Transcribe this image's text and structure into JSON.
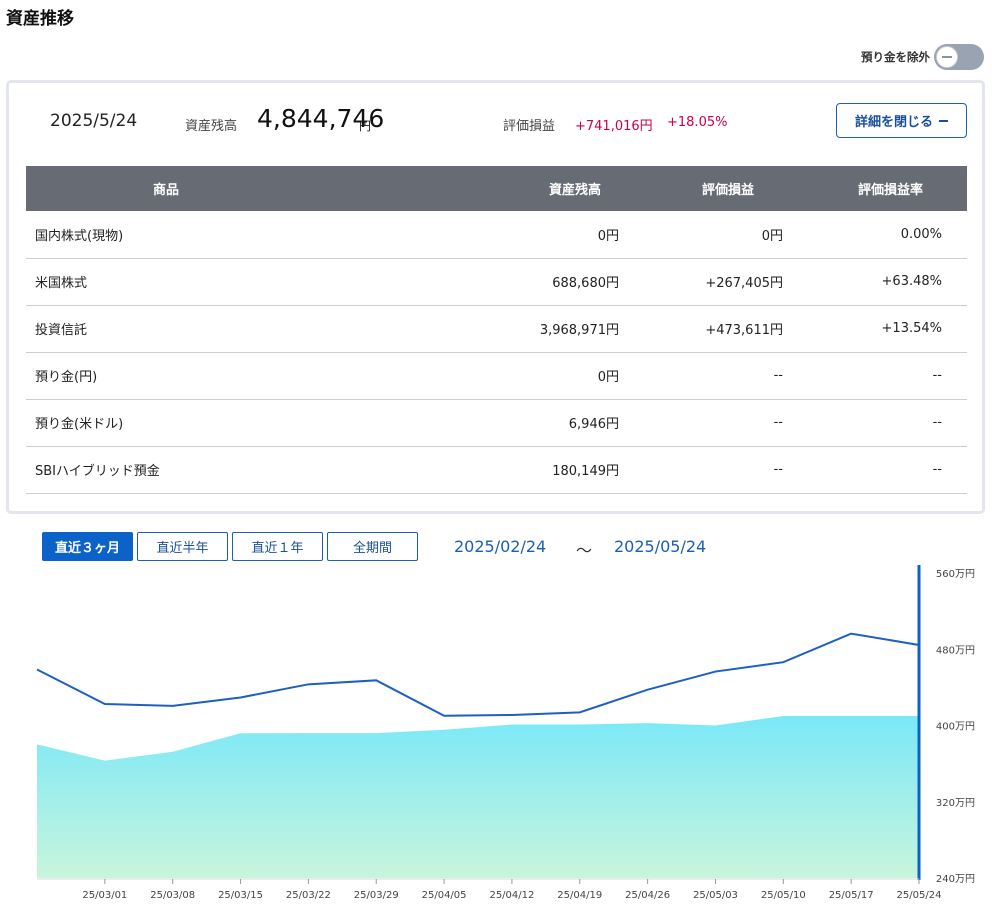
{
  "page_title": "資産推移",
  "toggle": {
    "label": "預り金を除外",
    "on": false
  },
  "summary": {
    "date": "2025/5/24",
    "balance_label": "資産残高",
    "balance_value": "4,844,746",
    "balance_unit": "円",
    "pl_label": "評価損益",
    "pl_amount": "+741,016円",
    "pl_rate": "+18.05%",
    "detail_button": "詳細を閉じる"
  },
  "table": {
    "headers": [
      "商品",
      "資産残高",
      "評価損益",
      "評価損益率"
    ],
    "rows": [
      {
        "name": "国内株式(現物)",
        "balance": "0円",
        "pl": "0円",
        "rate": "0.00%",
        "positive": false
      },
      {
        "name": "米国株式",
        "balance": "688,680円",
        "pl": "+267,405円",
        "rate": "+63.48%",
        "positive": true
      },
      {
        "name": "投資信託",
        "balance": "3,968,971円",
        "pl": "+473,611円",
        "rate": "+13.54%",
        "positive": true
      },
      {
        "name": "預り金(円)",
        "balance": "0円",
        "pl": "--",
        "rate": "--",
        "positive": false
      },
      {
        "name": "預り金(米ドル)",
        "balance": "6,946円",
        "pl": "--",
        "rate": "--",
        "positive": false
      },
      {
        "name": "SBIハイブリッド預金",
        "balance": "180,149円",
        "pl": "--",
        "rate": "--",
        "positive": false
      }
    ]
  },
  "periods": [
    {
      "label": "直近３ヶ月",
      "active": true
    },
    {
      "label": "直近半年",
      "active": false
    },
    {
      "label": "直近１年",
      "active": false
    },
    {
      "label": "全期間",
      "active": false
    }
  ],
  "range": {
    "start": "2025/02/24",
    "separator": "～",
    "end": "2025/05/24"
  },
  "colors": {
    "accent": "#0b63c9",
    "positive": "#c8004f",
    "line": "#1d5fc4",
    "area_top": "#7ae8f8",
    "area_bottom": "#c8f5dc"
  },
  "chart_data": {
    "type": "line",
    "x": [
      "25/02/24",
      "25/03/01",
      "25/03/08",
      "25/03/15",
      "25/03/22",
      "25/03/29",
      "25/04/05",
      "25/04/12",
      "25/04/19",
      "25/04/26",
      "25/05/03",
      "25/05/10",
      "25/05/17",
      "25/05/24"
    ],
    "xticks": [
      "25/03/01",
      "25/03/08",
      "25/03/15",
      "25/03/22",
      "25/03/29",
      "25/04/05",
      "25/04/12",
      "25/04/19",
      "25/04/26",
      "25/05/03",
      "25/05/10",
      "25/05/17",
      "25/05/24"
    ],
    "series": [
      {
        "kind": "line",
        "values": [
          4588000,
          4226000,
          4206000,
          4294000,
          4432000,
          4474000,
          4102000,
          4110000,
          4138000,
          4376000,
          4566000,
          4664000,
          4964000,
          4845000
        ]
      },
      {
        "kind": "area",
        "values": [
          3802000,
          3632000,
          3724000,
          3919000,
          3920000,
          3920000,
          3955000,
          4010000,
          4010000,
          4025000,
          4000000,
          4100000,
          4100000,
          4100000
        ]
      }
    ],
    "yticks": [
      "240万円",
      "320万円",
      "400万円",
      "480万円",
      "560万円"
    ],
    "ylim": [
      2400000,
      5600000
    ],
    "grid": false,
    "selected_date": "25/05/24"
  }
}
